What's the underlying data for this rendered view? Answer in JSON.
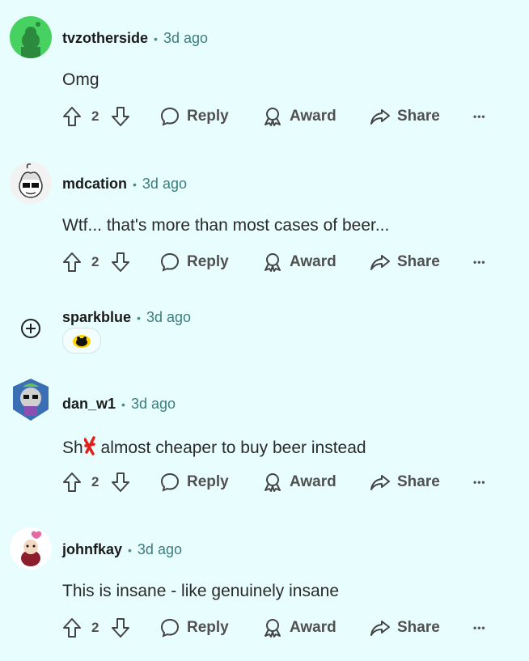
{
  "comments": [
    {
      "author": "tvzotherside",
      "time": "3d ago",
      "text": "Omg",
      "votes": "2"
    },
    {
      "author": "mdcation",
      "time": "3d ago",
      "text": "Wtf... that's more than most cases of beer...",
      "votes": "2"
    },
    {
      "author": "sparkblue",
      "time": "3d ago",
      "text": "",
      "votes": ""
    },
    {
      "author": "dan_w1",
      "time": "3d ago",
      "text_prefix": "Sh",
      "text_rest": "almost cheaper to buy beer instead",
      "votes": "2"
    },
    {
      "author": "johnfkay",
      "time": "3d ago",
      "text": "This is insane - like genuinely insane",
      "votes": "2"
    }
  ],
  "actions": {
    "reply": "Reply",
    "award": "Award",
    "share": "Share",
    "more": "•••"
  },
  "separator": "•",
  "colors": {
    "background": "#e8fdfd",
    "meta": "#3b7c7c",
    "avatar_green": "#46d160"
  }
}
